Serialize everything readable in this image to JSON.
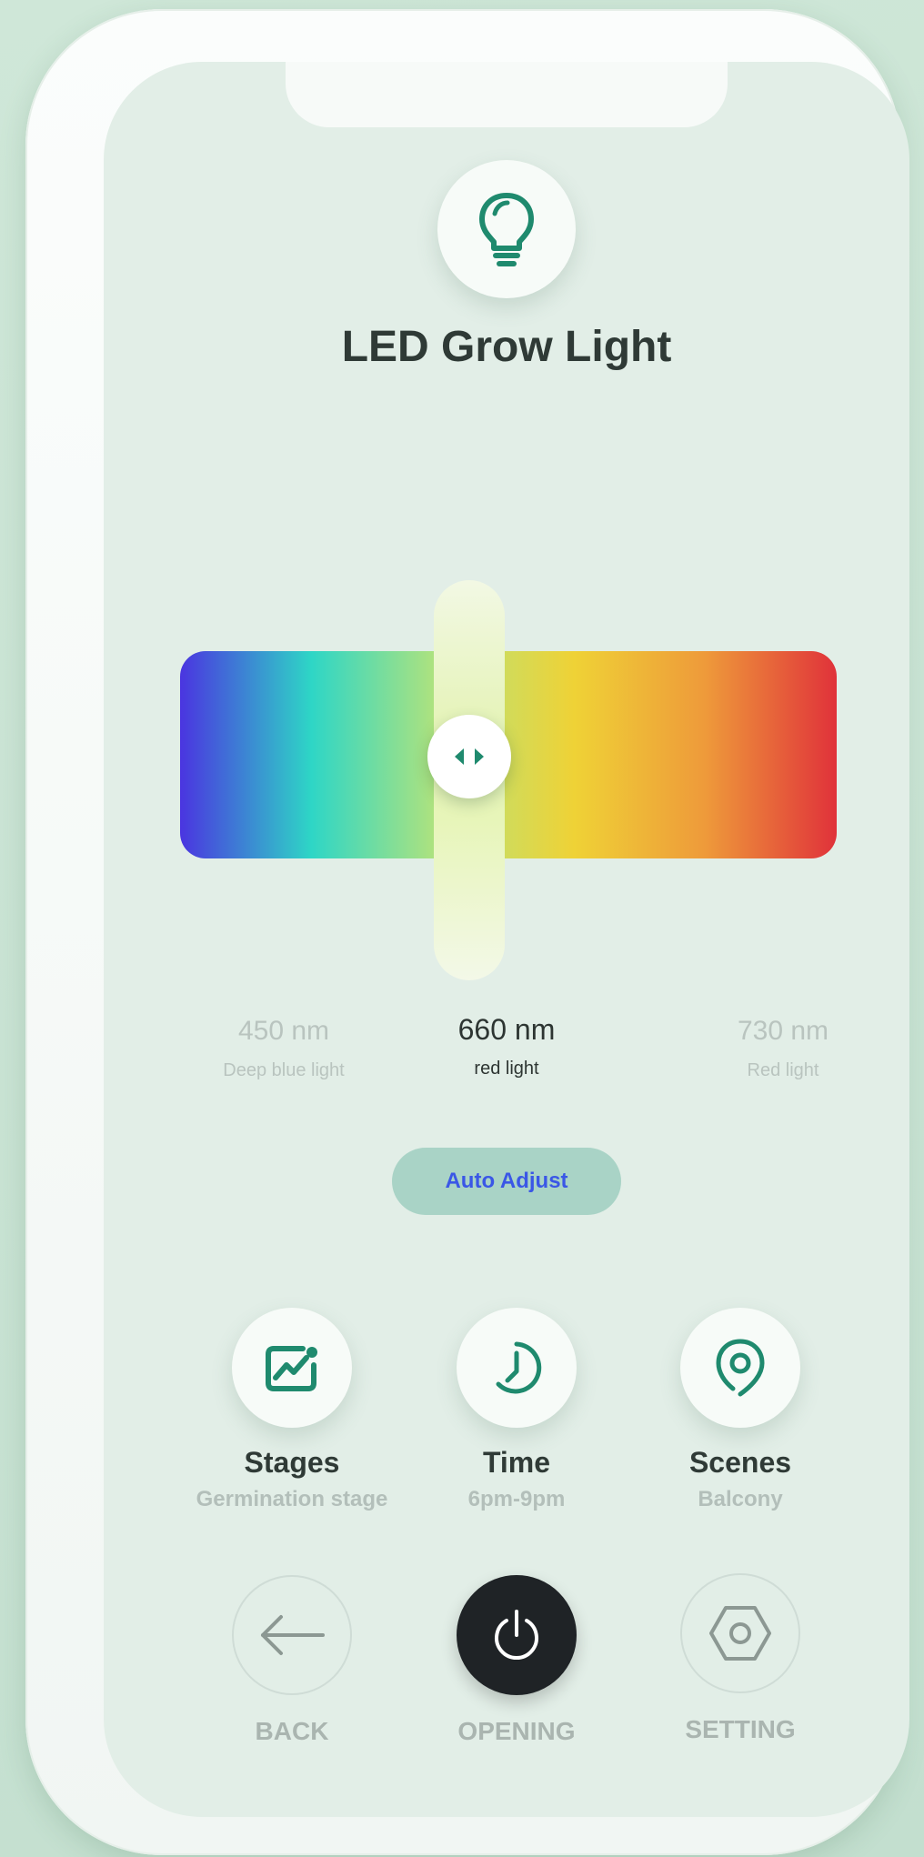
{
  "app": {
    "title": "LED Grow Light",
    "icon": "lightbulb-icon",
    "accent_color": "#1f8a6e"
  },
  "spectrum": {
    "selected_index": 1,
    "position_fraction": 0.44,
    "wavelengths": [
      {
        "value": "450 nm",
        "label": "Deep blue light"
      },
      {
        "value": "660 nm",
        "label": "red light"
      },
      {
        "value": "730 nm",
        "label": "Red light"
      }
    ],
    "colors": [
      "#4a35e0",
      "#2ed6c6",
      "#b6e37a",
      "#efd236",
      "#ee9a3a",
      "#e0323a"
    ]
  },
  "auto_adjust": {
    "label": "Auto Adjust",
    "text_color": "#3a57e6",
    "bg_color": "#a9d3c6"
  },
  "features": [
    {
      "label": "Stages",
      "value": "Germination stage",
      "icon": "chart-icon"
    },
    {
      "label": "Time",
      "value": "6pm-9pm",
      "icon": "clock-icon"
    },
    {
      "label": "Scenes",
      "value": "Balcony",
      "icon": "location-pin-icon"
    }
  ],
  "nav": {
    "back": {
      "label": "BACK",
      "icon": "arrow-left-icon"
    },
    "power": {
      "label": "OPENING",
      "icon": "power-icon"
    },
    "setting": {
      "label": "SETTING",
      "icon": "hexagon-nut-icon"
    }
  }
}
